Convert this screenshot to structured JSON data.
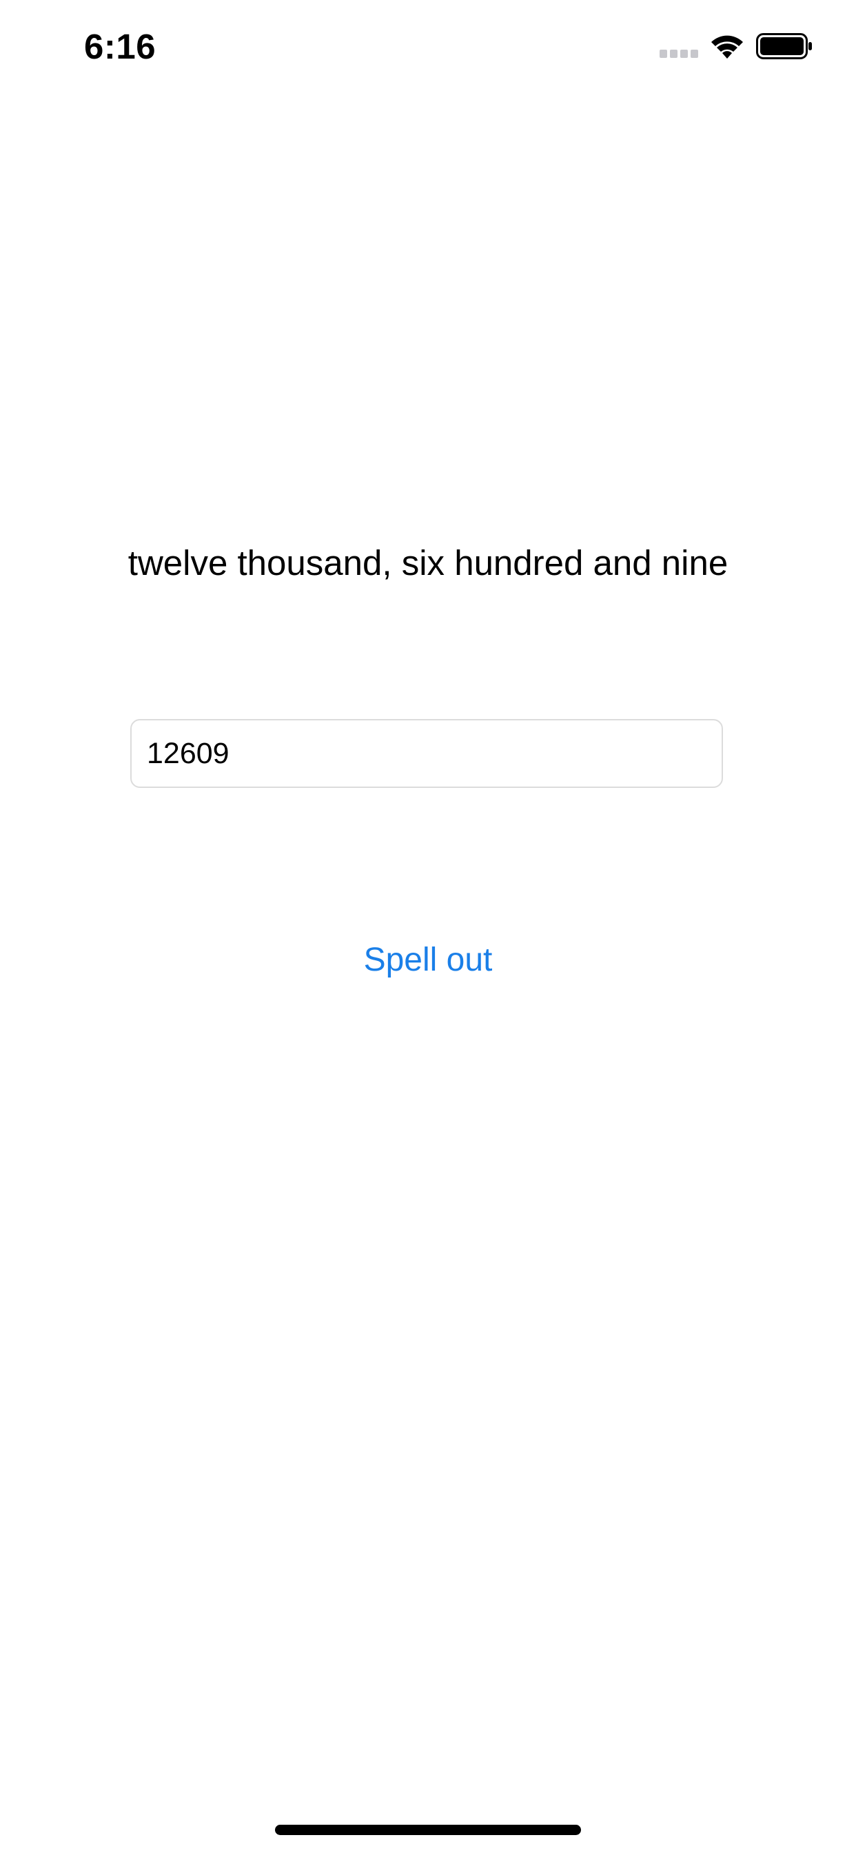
{
  "status_bar": {
    "time": "6:16",
    "icons": [
      "signal-icon",
      "wifi-icon",
      "battery-icon"
    ]
  },
  "main": {
    "result_text": "twelve thousand, six hundred and nine",
    "number_field": {
      "value": "12609"
    },
    "spell_button_label": "Spell out"
  },
  "colors": {
    "accent": "#1a7fe8",
    "text": "#000000",
    "background": "#ffffff",
    "field_border": "#dcdcdc"
  }
}
